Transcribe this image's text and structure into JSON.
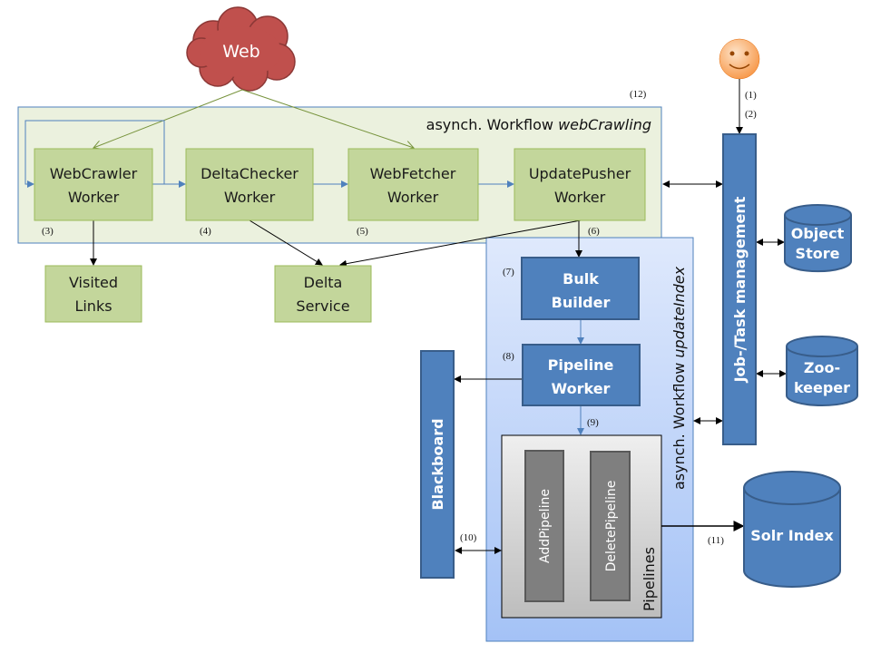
{
  "colors": {
    "web_cloud": "#c0504d",
    "green_fill": "#c3d69b",
    "green_border": "#9bbb59",
    "blue_fill": "#4f81bd",
    "blue_border": "#385d8a",
    "gray_fill": "#7f7f7f"
  },
  "web": {
    "label": "Web"
  },
  "user": {
    "icon": "smiley-face-icon"
  },
  "crawl_workflow": {
    "title_prefix": "asynch. Workflow ",
    "title_name": "webCrawling",
    "step": "(12)"
  },
  "workers": [
    {
      "line1": "WebCrawler",
      "line2": "Worker",
      "step": "(3)"
    },
    {
      "line1": "DeltaChecker",
      "line2": "Worker",
      "step": "(4)"
    },
    {
      "line1": "WebFetcher",
      "line2": "Worker",
      "step": "(5)"
    },
    {
      "line1": "UpdatePusher",
      "line2": "Worker",
      "step": "(6)"
    }
  ],
  "visited_links": {
    "line1": "Visited",
    "line2": "Links"
  },
  "delta_service": {
    "line1": "Delta",
    "line2": "Service"
  },
  "job_management": {
    "label": "Job-/Task management",
    "step1": "(1)",
    "step2": "(2)"
  },
  "object_store": {
    "line1": "Object",
    "line2": "Store"
  },
  "zookeeper": {
    "line1": "Zoo-",
    "line2": "keeper"
  },
  "solr": {
    "label": "Solr Index",
    "step": "(11)"
  },
  "index_workflow": {
    "title_prefix": "asynch. Workflow ",
    "title_name": "updateIndex"
  },
  "bulk_builder": {
    "line1": "Bulk",
    "line2": "Builder",
    "step": "(7)"
  },
  "pipeline_worker": {
    "line1": "Pipeline",
    "line2": "Worker",
    "step": "(8)",
    "step_out": "(9)"
  },
  "pipelines": {
    "label": "Pipelines",
    "add": "AddPipeline",
    "delete": "DeletePipeline"
  },
  "blackboard": {
    "label": "Blackboard",
    "step": "(10)"
  }
}
